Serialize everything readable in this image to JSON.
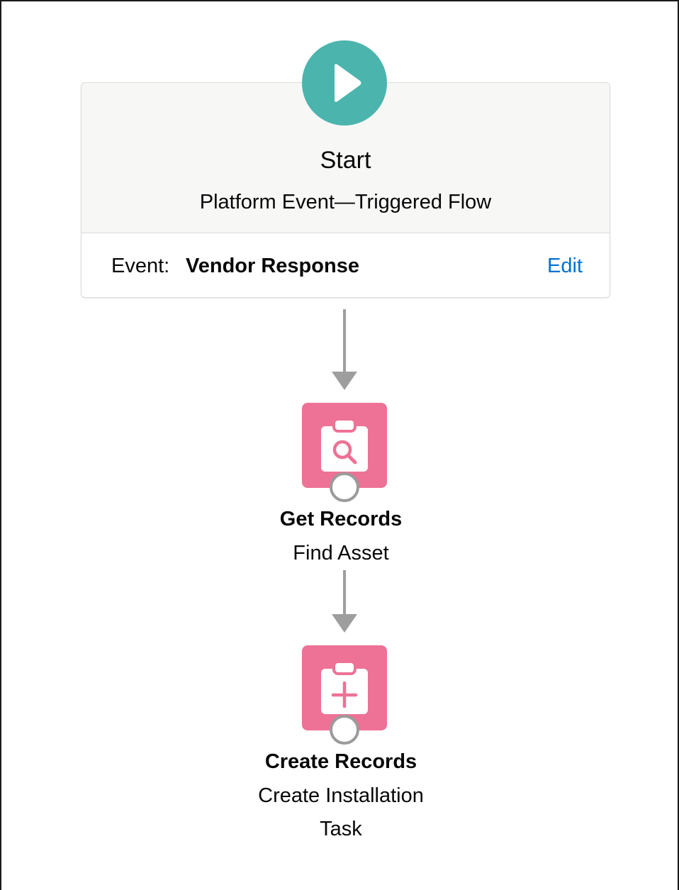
{
  "start": {
    "title": "Start",
    "subtitle": "Platform Event—Triggered Flow",
    "event_label": "Event:",
    "event_value": "Vendor Response",
    "edit_label": "Edit"
  },
  "nodes": [
    {
      "icon": "get-records-icon",
      "title": "Get Records",
      "description": "Find Asset"
    },
    {
      "icon": "create-records-icon",
      "title": "Create Records",
      "description_line1": "Create Installation",
      "description_line2": "Task"
    }
  ],
  "colors": {
    "start_icon": "#4bb4ad",
    "record_icon": "#ed7295",
    "link": "#0070d2",
    "connector": "#9e9e9e"
  }
}
